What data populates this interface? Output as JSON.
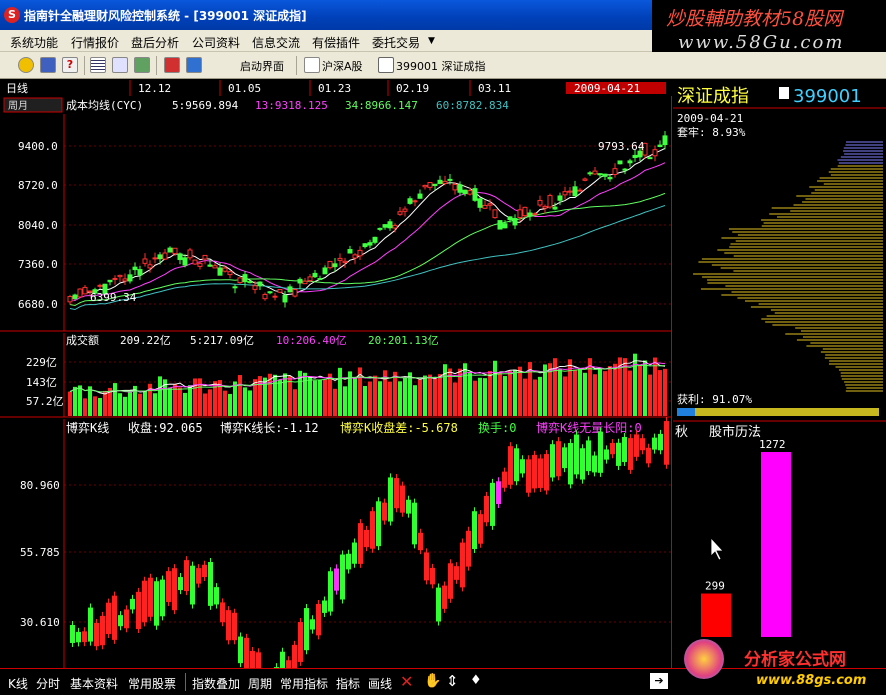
{
  "window": {
    "title": "指南针全融理财风险控制系统 - [399001 深证成指]",
    "app_icon": "compass-app-icon"
  },
  "ad_banner": {
    "line1_a": "炒股輔助教材",
    "line1_b": "58股网",
    "line2": "www.58Gu.com"
  },
  "menu": [
    "系统功能",
    "行情报价",
    "盘后分析",
    "公司资料",
    "信息交流",
    "有偿插件",
    "委托交易"
  ],
  "toolbar": {
    "startup_label": "启动界面",
    "market_label": "沪深A股",
    "stock_label": "399001 深证成指"
  },
  "kline_panel": {
    "period_label": "日线",
    "period_btn": "周月",
    "indicator_name": "成本均线(CYC)",
    "cyc5": "5:9569.894",
    "cyc13": "13:9318.125",
    "cyc34": "34:8966.147",
    "cyc60": "60:8782.834",
    "dates": [
      "12.12",
      "01.05",
      "01.23",
      "02.19",
      "03.11"
    ],
    "current_date": "2009-04-21",
    "high_note": "9793.64",
    "low_note": "6399.34",
    "y_ticks": [
      "9400.0",
      "8720.0",
      "8040.0",
      "7360.0",
      "6680.0"
    ],
    "colors": {
      "cyc5": "#ffffff",
      "cyc13": "#ff40ff",
      "cyc34": "#60ff60",
      "cyc60": "#40c0c0"
    }
  },
  "volume_panel": {
    "title": "成交额",
    "amount": "209.22亿",
    "ma5": "5:217.09亿",
    "ma10": "10:206.40亿",
    "ma20": "20:201.13亿",
    "y_ticks": [
      "229亿",
      "143亿",
      "57.2亿"
    ]
  },
  "game_panel": {
    "title": "博弈K线",
    "close": "收盘:92.065",
    "length": "博弈K线长:-1.12",
    "diff": "博弈K收盘差:-5.678",
    "turnover": "换手:0",
    "no_shadow": "博弈K线无量长阳:0",
    "y_ticks": [
      "80.960",
      "55.785",
      "30.610"
    ]
  },
  "right_panel": {
    "index_name": "深证成指",
    "index_code": "399001",
    "date": "2009-04-21",
    "trapped": "套牢: 8.93%",
    "profit": "获利: 91.07%",
    "tab_autumn": "秋",
    "calendar": "股市历法",
    "bar1_label": "299",
    "bar2_label": "1272",
    "bar_values": [
      299,
      1272
    ]
  },
  "bottom_tabs": [
    "K线",
    "分时",
    "基本资料",
    "常用股票",
    "指数叠加",
    "周期",
    "常用指标",
    "指标",
    "画线"
  ],
  "watermark": {
    "name": "分析家公式网",
    "url": "www.88gs.com"
  }
}
